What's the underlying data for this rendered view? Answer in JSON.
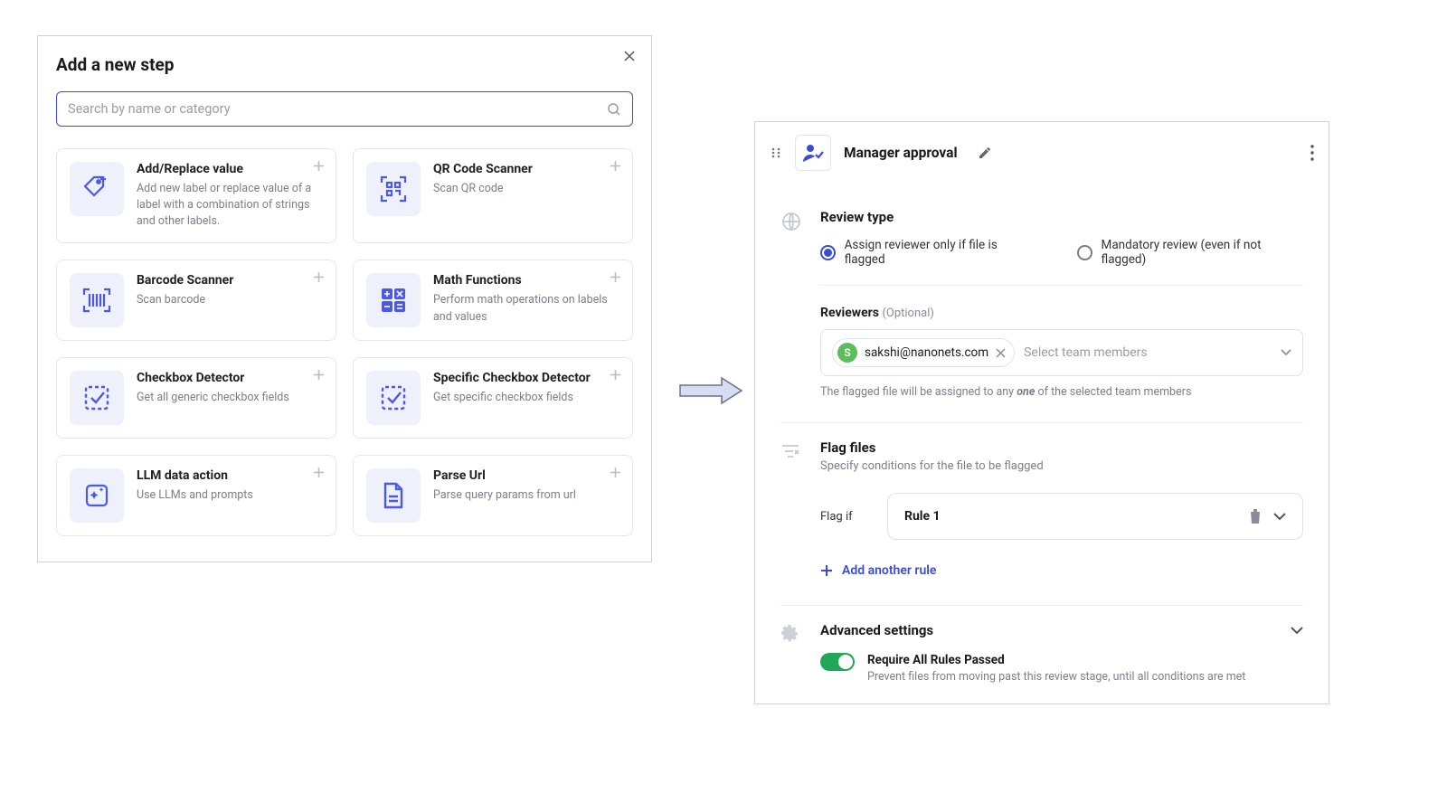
{
  "left": {
    "title": "Add a new step",
    "search_placeholder": "Search by name or category",
    "steps": [
      {
        "title": "Add/Replace value",
        "desc": "Add new label or replace value of a label with a combination of strings and other labels.",
        "icon": "tag-plus"
      },
      {
        "title": "QR Code Scanner",
        "desc": "Scan QR code",
        "icon": "qr"
      },
      {
        "title": "Barcode Scanner",
        "desc": "Scan barcode",
        "icon": "barcode"
      },
      {
        "title": "Math Functions",
        "desc": "Perform math operations on labels and values",
        "icon": "calc"
      },
      {
        "title": "Checkbox Detector",
        "desc": "Get all generic checkbox fields",
        "icon": "checkbox"
      },
      {
        "title": "Specific Checkbox Detector",
        "desc": "Get specific checkbox fields",
        "icon": "checkbox"
      },
      {
        "title": "LLM data action",
        "desc": "Use LLMs and prompts",
        "icon": "sparkle"
      },
      {
        "title": "Parse Url",
        "desc": "Parse query params from url",
        "icon": "file"
      }
    ]
  },
  "right": {
    "title": "Manager approval",
    "review_section": "Review type",
    "radio_assign": "Assign reviewer only if file is flagged",
    "radio_mandatory": "Mandatory review (even if not flagged)",
    "reviewers_label": "Reviewers",
    "optional": "(Optional)",
    "reviewer_email": "sakshi@nanonets.com",
    "reviewer_initial": "S",
    "reviewers_placeholder": "Select team members",
    "reviewers_help_prefix": "The flagged file will be assigned to any ",
    "reviewers_help_bold": "one",
    "reviewers_help_suffix": " of the selected team members",
    "flag_title": "Flag files",
    "flag_sub": "Specify conditions for the file to be flagged",
    "flag_if": "Flag if",
    "rule_name": "Rule 1",
    "add_rule": "Add another rule",
    "adv_title": "Advanced settings",
    "toggle_title": "Require All Rules Passed",
    "toggle_desc": "Prevent files from moving past this review stage, until all conditions are met"
  }
}
